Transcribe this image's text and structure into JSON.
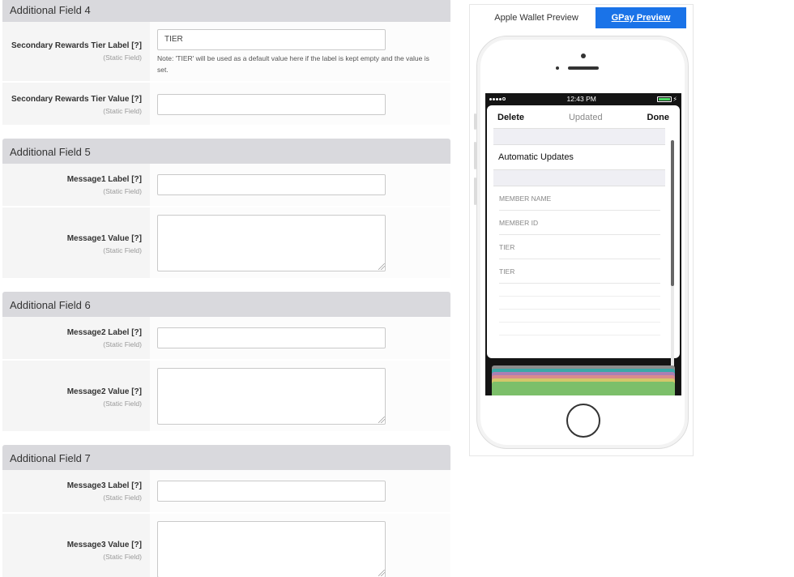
{
  "form": {
    "field4": {
      "title": "Additional Field 4",
      "label_row": {
        "label": "Secondary Rewards Tier Label",
        "hint": "[?]",
        "sub": "(Static Field)",
        "value": "TIER",
        "note": "Note: 'TIER' will be used as a default value here if the label is kept empty and the value is set."
      },
      "value_row": {
        "label": "Secondary Rewards Tier Value",
        "hint": "[?]",
        "sub": "(Static Field)",
        "value": ""
      }
    },
    "field5": {
      "title": "Additional Field 5",
      "label_row": {
        "label": "Message1 Label",
        "hint": "[?]",
        "sub": "(Static Field)",
        "value": ""
      },
      "value_row": {
        "label": "Message1 Value",
        "hint": "[?]",
        "sub": "(Static Field)",
        "value": ""
      }
    },
    "field6": {
      "title": "Additional Field 6",
      "label_row": {
        "label": "Message2 Label",
        "hint": "[?]",
        "sub": "(Static Field)",
        "value": ""
      },
      "value_row": {
        "label": "Message2 Value",
        "hint": "[?]",
        "sub": "(Static Field)",
        "value": ""
      }
    },
    "field7": {
      "title": "Additional Field 7",
      "label_row": {
        "label": "Message3 Label",
        "hint": "[?]",
        "sub": "(Static Field)",
        "value": ""
      },
      "value_row": {
        "label": "Message3 Value",
        "hint": "[?]",
        "sub": "(Static Field)",
        "value": ""
      }
    }
  },
  "preview": {
    "tabs": {
      "apple": "Apple Wallet Preview",
      "gpay": "GPay Preview"
    },
    "phone": {
      "time": "12:43 PM",
      "nav": {
        "delete": "Delete",
        "updated": "Updated",
        "done": "Done"
      },
      "automatic_updates": "Automatic Updates",
      "items": [
        "MEMBER NAME",
        "MEMBER ID",
        "TIER",
        "TIER"
      ]
    }
  },
  "colors": {
    "gpay_tab": "#1a73e8",
    "section_header": "#d9d9dd",
    "battery": "#4cd964",
    "card_stack": [
      "#8c8c8c",
      "#3aa8a8",
      "#a97fb4",
      "#d98c8c",
      "#d4c76a",
      "#7cbf6a"
    ]
  }
}
